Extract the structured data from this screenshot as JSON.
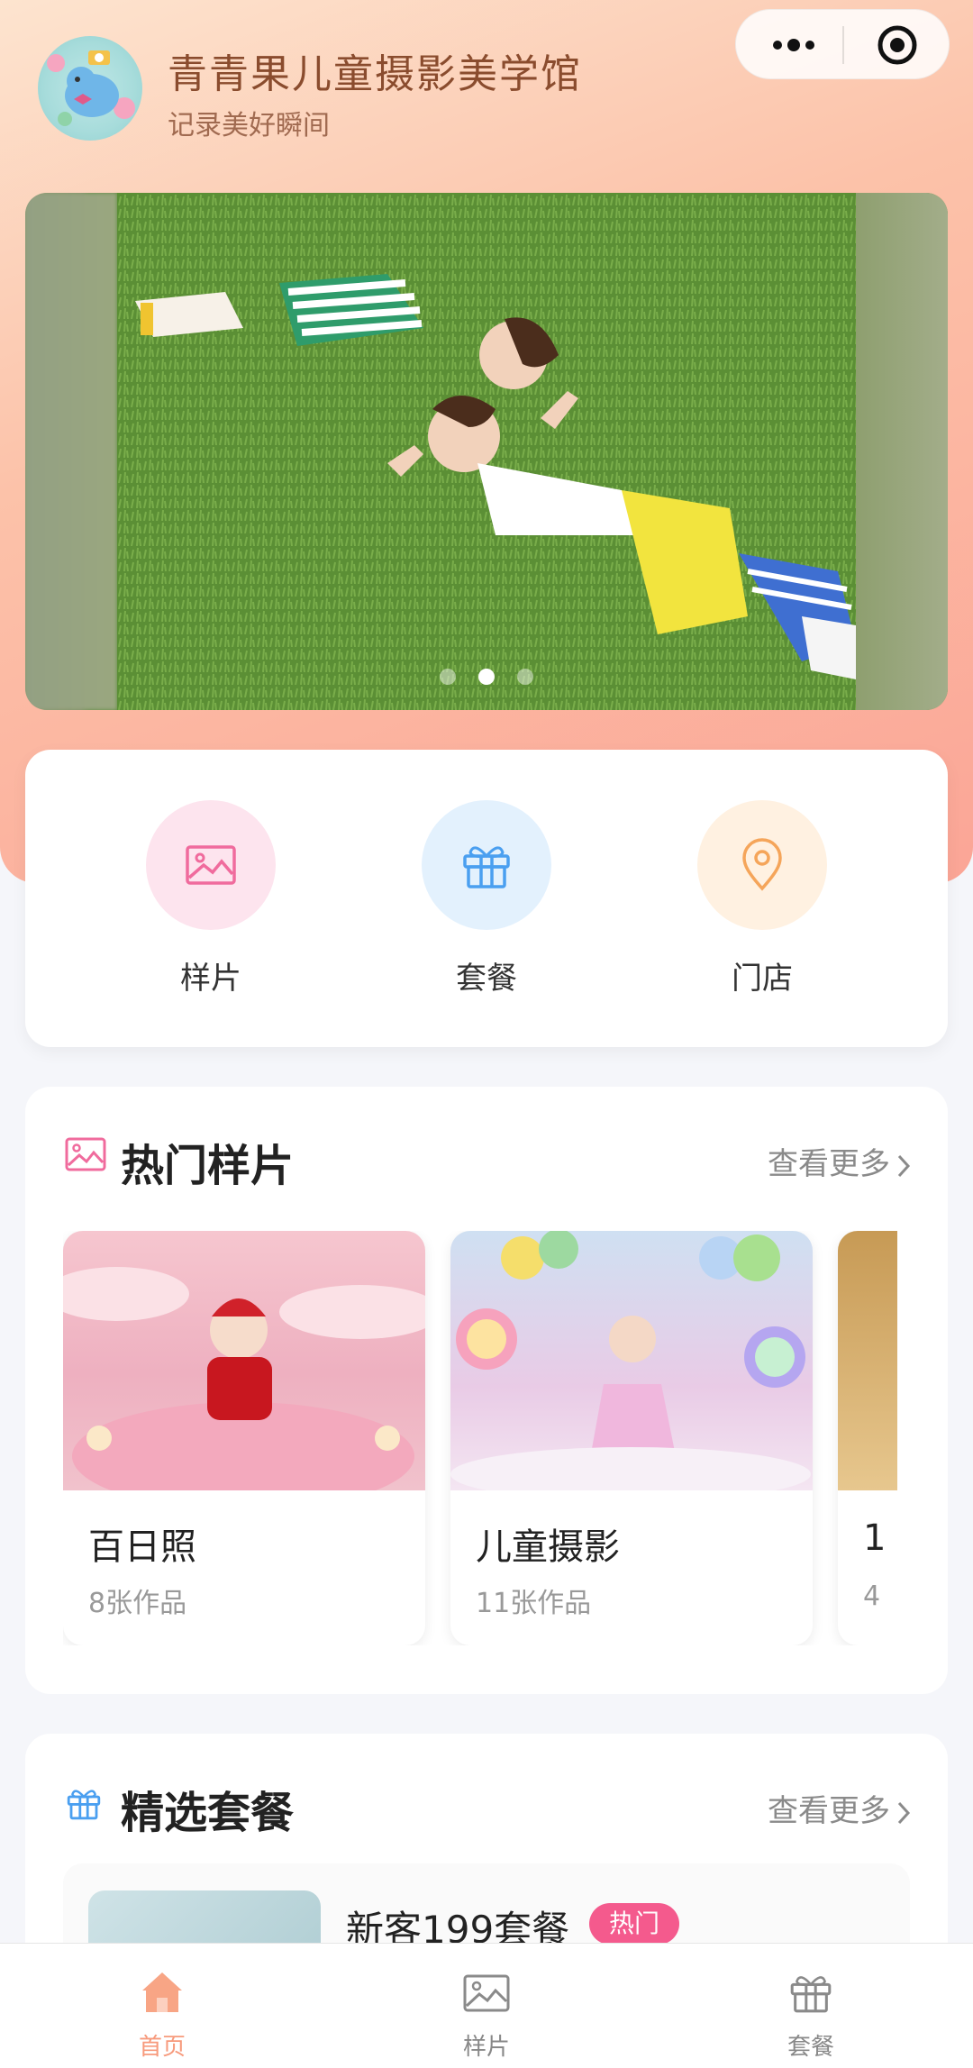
{
  "header": {
    "title": "青青果儿童摄影美学馆",
    "subtitle": "记录美好瞬间"
  },
  "banner": {
    "slide_count": 3,
    "active_index": 1
  },
  "quick_links": [
    {
      "label": "样片",
      "icon": "image-icon",
      "color": "#f06b9d",
      "bg": "#fde4ee"
    },
    {
      "label": "套餐",
      "icon": "gift-icon",
      "color": "#4a9ff0",
      "bg": "#e3f1fd"
    },
    {
      "label": "门店",
      "icon": "location-pin-icon",
      "color": "#f5a55a",
      "bg": "#fff1e1"
    }
  ],
  "hot_samples": {
    "title": "热门样片",
    "more_label": "查看更多",
    "items": [
      {
        "name": "百日照",
        "count": "8张作品"
      },
      {
        "name": "儿童摄影",
        "count": "11张作品"
      },
      {
        "name": "1",
        "count": "4"
      }
    ]
  },
  "featured_packages": {
    "title": "精选套餐",
    "more_label": "查看更多",
    "items": [
      {
        "name": "新客199套餐",
        "badge": "热门"
      }
    ]
  },
  "tabbar": [
    {
      "label": "首页",
      "active": true
    },
    {
      "label": "样片",
      "active": false
    },
    {
      "label": "套餐",
      "active": false
    }
  ],
  "colors": {
    "accent": "#f79a7c",
    "hot_badge": "#f45a8d"
  }
}
